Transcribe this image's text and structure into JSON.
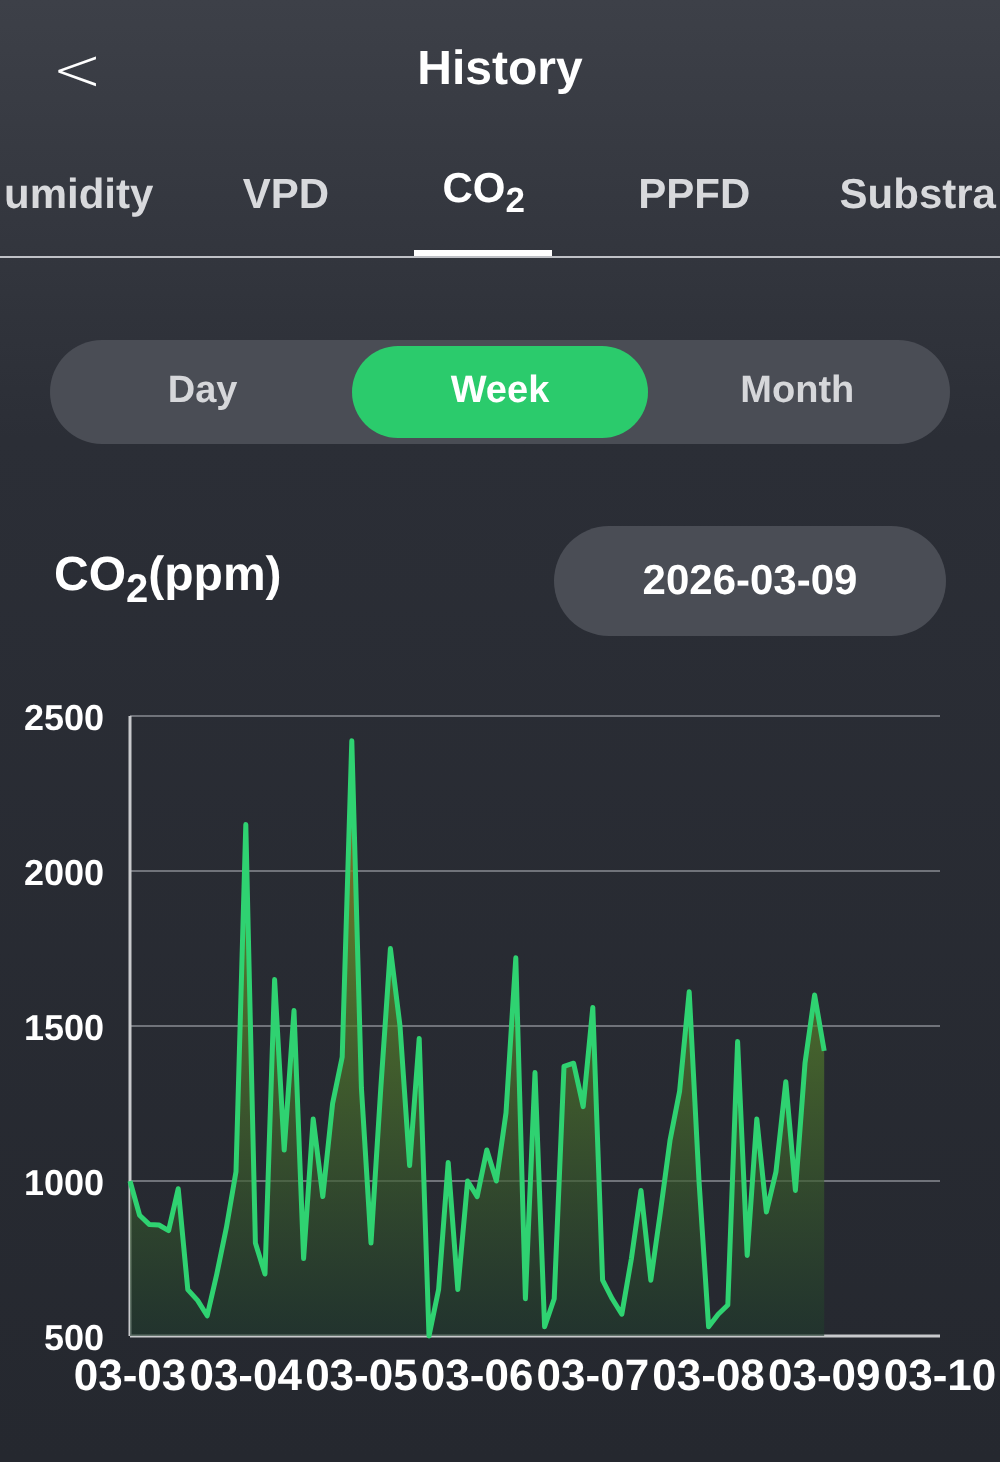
{
  "header": {
    "back": "<",
    "title": "History"
  },
  "tabs": [
    {
      "label": "umidity",
      "selected": false
    },
    {
      "label": "VPD",
      "selected": false
    },
    {
      "label": "CO$_{2}$",
      "selected": true
    },
    {
      "label": "PPFD",
      "selected": false
    },
    {
      "label": "Substra",
      "selected": false
    }
  ],
  "periods": [
    {
      "label": "Day",
      "selected": false
    },
    {
      "label": "Week",
      "selected": true
    },
    {
      "label": "Month",
      "selected": false
    }
  ],
  "date": "2026-03-09",
  "chart_data": {
    "type": "area",
    "grid": true,
    "ylim": [
      500,
      2500
    ],
    "yticks": [
      500,
      1000,
      1500,
      2000,
      2500
    ],
    "categories": [
      "03-03",
      null,
      null,
      null,
      null,
      null,
      null,
      null,
      null,
      null,
      null,
      null,
      "03-04",
      null,
      null,
      null,
      null,
      null,
      null,
      null,
      null,
      null,
      null,
      null,
      "03-05",
      null,
      null,
      null,
      null,
      null,
      null,
      null,
      null,
      null,
      null,
      null,
      "03-06",
      null,
      null,
      null,
      null,
      null,
      null,
      null,
      null,
      null,
      null,
      null,
      "03-07",
      null,
      null,
      null,
      null,
      null,
      null,
      null,
      null,
      null,
      null,
      null,
      "03-08",
      null,
      null,
      null,
      null,
      null,
      null,
      null,
      null,
      null,
      null,
      null,
      "03-09",
      null,
      null,
      null,
      null,
      null,
      null,
      null,
      null,
      null,
      null,
      null,
      "03-10"
    ],
    "series": [
      {
        "name": "CO$_{2}$(ppm)",
        "color": "#2fd271",
        "values": [
          1000,
          890,
          860,
          858,
          840,
          975,
          650,
          615,
          565,
          700,
          850,
          1030,
          2150,
          800,
          700,
          1650,
          1100,
          1550,
          750,
          1200,
          950,
          1250,
          1400,
          2420,
          1300,
          800,
          1300,
          1750,
          1500,
          1050,
          1460,
          500,
          650,
          1060,
          650,
          1000,
          950,
          1100,
          1000,
          1220,
          1720,
          620,
          1350,
          530,
          620,
          1370,
          1380,
          1240,
          1560,
          680,
          620,
          570,
          750,
          970,
          680,
          900,
          1130,
          1290,
          1610,
          1000,
          530,
          570,
          600,
          1450,
          760,
          1200,
          900,
          1030,
          1320,
          970,
          1380,
          1600,
          1420,
          null,
          null,
          null,
          null,
          null,
          null,
          null,
          null,
          null,
          null,
          null,
          null
        ]
      }
    ]
  }
}
